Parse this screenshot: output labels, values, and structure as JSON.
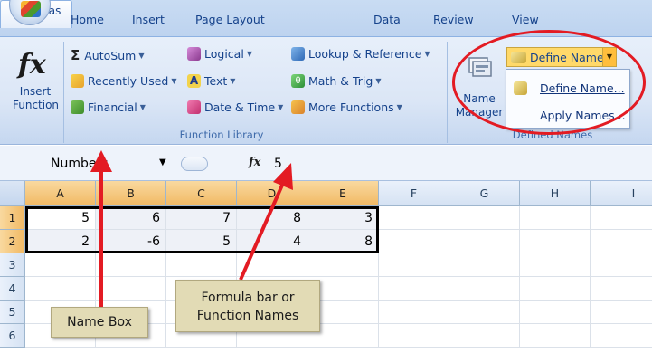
{
  "tabs": [
    "Home",
    "Insert",
    "Page Layout",
    "Formulas",
    "Data",
    "Review",
    "View"
  ],
  "active_tab": "Formulas",
  "ribbon": {
    "insert_function": {
      "symbol": "fx",
      "line1": "Insert",
      "line2": "Function"
    },
    "function_library": {
      "label": "Function Library",
      "col1": [
        "AutoSum",
        "Recently Used",
        "Financial"
      ],
      "col2": [
        "Logical",
        "Text",
        "Date & Time"
      ],
      "col3": [
        "Lookup & Reference",
        "Math & Trig",
        "More Functions"
      ]
    },
    "defined_names": {
      "label": "Defined Names",
      "name_manager_line1": "Name",
      "name_manager_line2": "Manager",
      "define_name_button": "Define Name",
      "dropdown": [
        "Define Name...",
        "Apply Names..."
      ]
    }
  },
  "formula_bar": {
    "name_box": "Numbers",
    "fx": "fx",
    "value": "5"
  },
  "grid": {
    "columns": [
      "A",
      "B",
      "C",
      "D",
      "E",
      "F",
      "G",
      "H",
      "I"
    ],
    "rows": [
      "1",
      "2",
      "3",
      "4",
      "5",
      "6"
    ],
    "data": [
      [
        "5",
        "6",
        "7",
        "8",
        "3"
      ],
      [
        "2",
        "-6",
        "5",
        "4",
        "8"
      ]
    ]
  },
  "annotations": {
    "name_box": "Name Box",
    "formula_line1": "Formula bar or",
    "formula_line2": "Function Names"
  },
  "colors": {
    "callout": "#e31b23",
    "ribbon": "#dbe6f6",
    "selected_header": "#f1b964"
  }
}
